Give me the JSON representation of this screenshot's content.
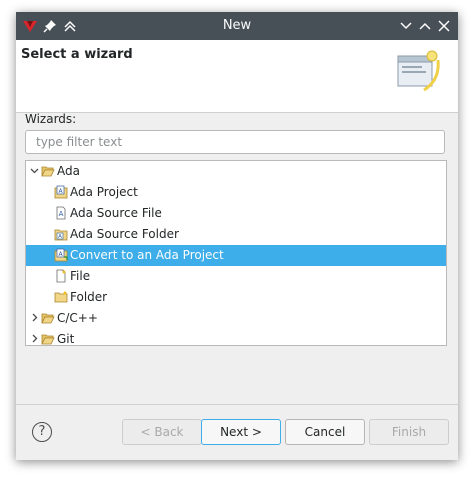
{
  "window": {
    "title": "New"
  },
  "banner": {
    "title": "Select a wizard"
  },
  "wizards_label": "Wizards:",
  "filter": {
    "placeholder": "type filter text",
    "value": ""
  },
  "tree": {
    "ada": "Ada",
    "ada_project": "Ada Project",
    "ada_source_file": "Ada Source File",
    "ada_source_folder": "Ada Source Folder",
    "convert": "Convert to an Ada Project",
    "file": "File",
    "folder": "Folder",
    "cpp": "C/C++",
    "git": "Git"
  },
  "buttons": {
    "help": "?",
    "back": "< Back",
    "next": "Next >",
    "cancel": "Cancel",
    "finish": "Finish"
  },
  "colors": {
    "selection": "#3daee9",
    "titlebar": "#475057"
  }
}
